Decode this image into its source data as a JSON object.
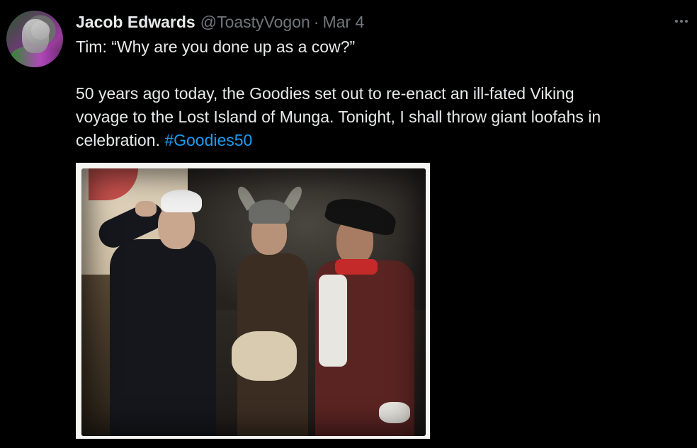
{
  "tweet": {
    "author": {
      "name": "Jacob Edwards",
      "handle": "@ToastyVogon",
      "separator": "·",
      "date": "Mar 4"
    },
    "text": {
      "line1": "Tim: “Why are you done up as a cow?”",
      "line2": "50 years ago today, the Goodies set out to re-enact an ill-fated Viking",
      "line3": "voyage to the Lost Island of Munga. Tonight, I shall throw giant loofahs in",
      "line4_prefix": "celebration. ",
      "hashtag": "#Goodies50"
    },
    "more_icon": "more-horizontal-icon",
    "media_alt": "photo"
  },
  "colors": {
    "background": "#000000",
    "text": "#e7e9ea",
    "muted": "#71767b",
    "link": "#1d9bf0"
  }
}
